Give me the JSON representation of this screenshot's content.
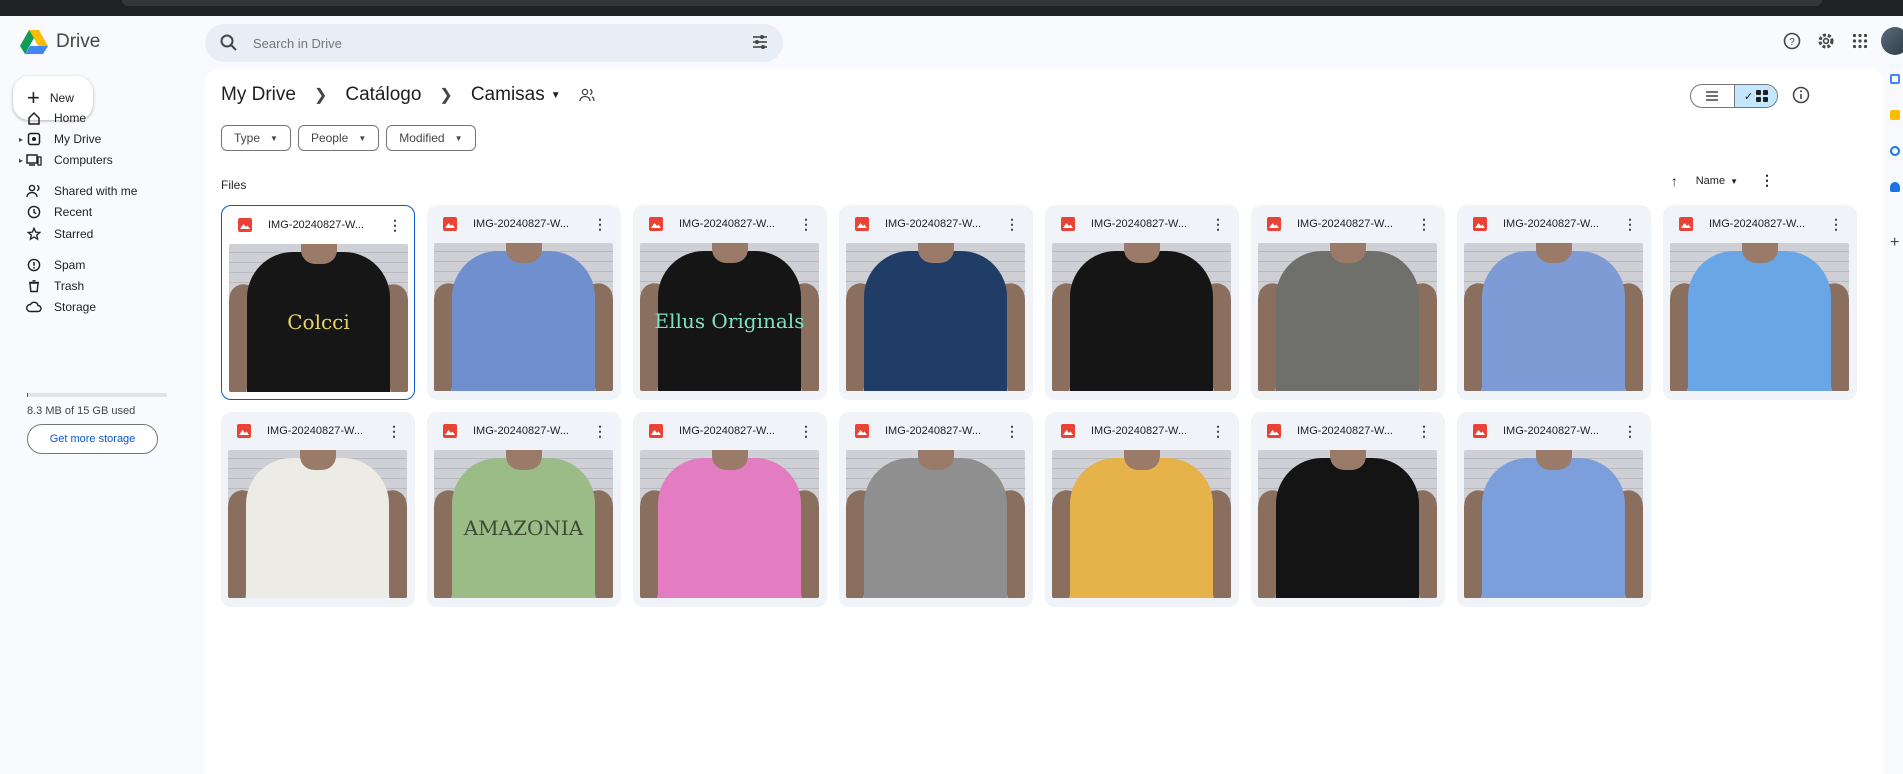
{
  "app": {
    "name": "Drive"
  },
  "search": {
    "placeholder": "Search in Drive",
    "value": ""
  },
  "header_icons": [
    "help-icon",
    "settings-icon",
    "apps-grid-icon",
    "account-avatar"
  ],
  "sidebar": {
    "new_label": "New",
    "items": [
      {
        "label": "Home",
        "icon": "home-icon",
        "caret": false
      },
      {
        "label": "My Drive",
        "icon": "my-drive-icon",
        "caret": true
      },
      {
        "label": "Computers",
        "icon": "computers-icon",
        "caret": true
      },
      {
        "label": "Shared with me",
        "icon": "shared-icon",
        "caret": false
      },
      {
        "label": "Recent",
        "icon": "clock-icon",
        "caret": false
      },
      {
        "label": "Starred",
        "icon": "star-icon",
        "caret": false
      },
      {
        "label": "Spam",
        "icon": "spam-icon",
        "caret": false
      },
      {
        "label": "Trash",
        "icon": "trash-icon",
        "caret": false
      },
      {
        "label": "Storage",
        "icon": "cloud-icon",
        "caret": false
      }
    ],
    "storage_used_fraction": 0.0006,
    "storage_text": "8.3 MB of 15 GB used",
    "get_more_label": "Get more storage"
  },
  "breadcrumb": {
    "items": [
      "My Drive",
      "Catálogo",
      "Camisas"
    ]
  },
  "filters": [
    {
      "label": "Type"
    },
    {
      "label": "People"
    },
    {
      "label": "Modified"
    }
  ],
  "section_label": "Files",
  "sort": {
    "label": "Name",
    "direction": "ascending"
  },
  "view": {
    "mode": "grid"
  },
  "files": [
    {
      "name": "IMG-20240827-W...",
      "selected": true,
      "shirt_color": "#161616",
      "print": "Colcci",
      "print_color": "#e8d46a"
    },
    {
      "name": "IMG-20240827-W...",
      "selected": false,
      "shirt_color": "#6f8fcf",
      "print": "",
      "print_color": "#ffffff"
    },
    {
      "name": "IMG-20240827-W...",
      "selected": false,
      "shirt_color": "#151515",
      "print": "Ellus Originals",
      "print_color": "#7fe0c2"
    },
    {
      "name": "IMG-20240827-W...",
      "selected": false,
      "shirt_color": "#1f3d66",
      "print": "",
      "print_color": "#c8b27a"
    },
    {
      "name": "IMG-20240827-W...",
      "selected": false,
      "shirt_color": "#151515",
      "print": "",
      "print_color": "#dddddd"
    },
    {
      "name": "IMG-20240827-W...",
      "selected": false,
      "shirt_color": "#6f6f6c",
      "print": "",
      "print_color": "#f1c82b"
    },
    {
      "name": "IMG-20240827-W...",
      "selected": false,
      "shirt_color": "#7f9bd6",
      "print": "",
      "print_color": "#333333"
    },
    {
      "name": "IMG-20240827-W...",
      "selected": false,
      "shirt_color": "#6aa6e6",
      "print": "",
      "print_color": "#24324a"
    },
    {
      "name": "IMG-20240827-W...",
      "selected": false,
      "shirt_color": "#ecebe6",
      "print": "",
      "print_color": "#333333"
    },
    {
      "name": "IMG-20240827-W...",
      "selected": false,
      "shirt_color": "#9cbc87",
      "print": "AMAZONIA",
      "print_color": "#3c4a36"
    },
    {
      "name": "IMG-20240827-W...",
      "selected": false,
      "shirt_color": "#e37cc0",
      "print": "",
      "print_color": "#777777"
    },
    {
      "name": "IMG-20240827-W...",
      "selected": false,
      "shirt_color": "#8f8f8f",
      "print": "",
      "print_color": "#555555"
    },
    {
      "name": "IMG-20240827-W...",
      "selected": false,
      "shirt_color": "#e6b24a",
      "print": "",
      "print_color": "#555555"
    },
    {
      "name": "IMG-20240827-W...",
      "selected": false,
      "shirt_color": "#141414",
      "print": "",
      "print_color": "#c8a64a"
    },
    {
      "name": "IMG-20240827-W...",
      "selected": false,
      "shirt_color": "#7c9edb",
      "print": "",
      "print_color": "#c04a3a"
    }
  ],
  "colors": {
    "accent": "#0b57d0",
    "selected_toggle": "#c2e7ff",
    "file_icon": "#ea4335",
    "card_bg": "#f0f4f9"
  }
}
